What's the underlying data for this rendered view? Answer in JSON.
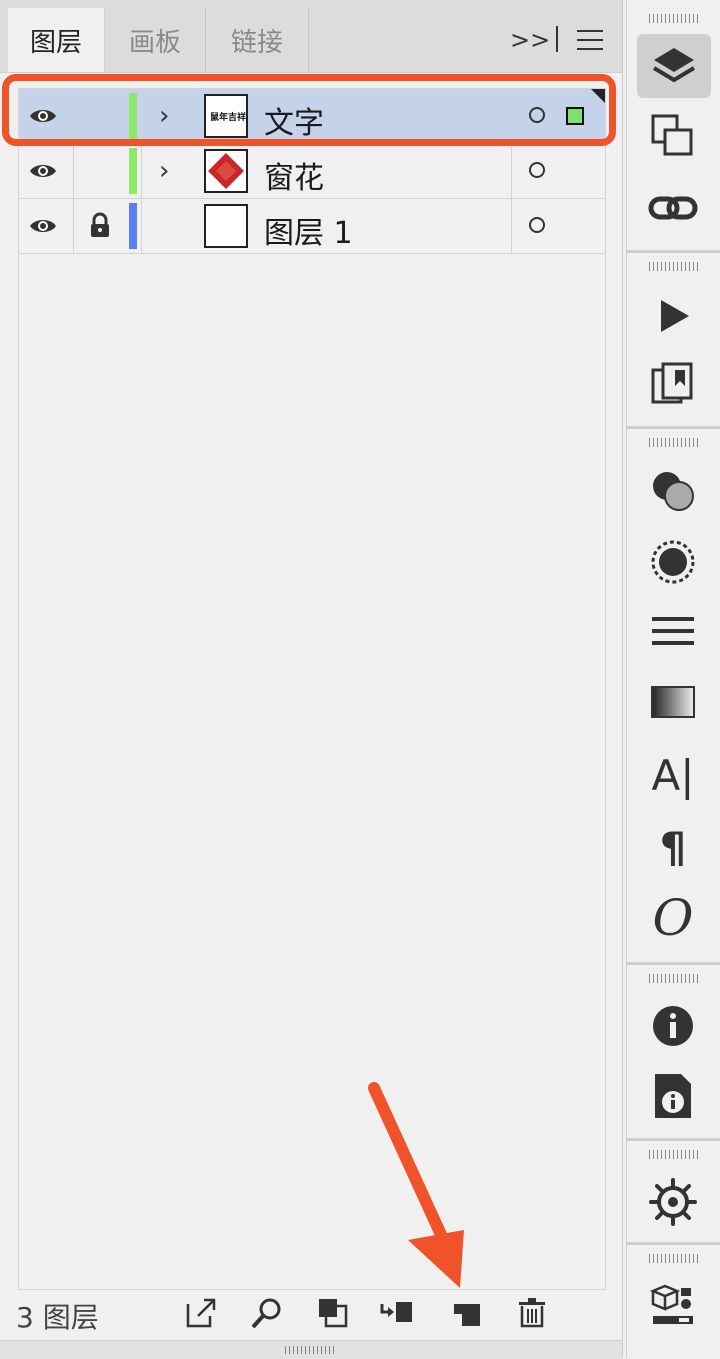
{
  "tabs": [
    {
      "label": "图层",
      "active": true
    },
    {
      "label": "画板",
      "active": false
    },
    {
      "label": "链接",
      "active": false
    }
  ],
  "tab_overflow_label": ">>",
  "layers": [
    {
      "name": "文字",
      "thumb_text": "鼠年吉祥",
      "color": "#8ee86b",
      "selected": true,
      "expandable": true,
      "locked": false
    },
    {
      "name": "窗花",
      "thumb_text": "",
      "color": "#8ee86b",
      "selected": false,
      "expandable": true,
      "locked": false
    },
    {
      "name": "图层 1",
      "thumb_text": "",
      "color": "#5b7ef0",
      "selected": false,
      "expandable": false,
      "locked": true
    }
  ],
  "footer": {
    "count_label": "3 图层"
  },
  "colors": {
    "highlight": "#f0522a",
    "selected_row": "#c5d3ea",
    "arrow": "#f0522a"
  },
  "footer_icons": [
    "export-icon",
    "search-icon",
    "clip-mask-icon",
    "move-to-layer-icon",
    "new-sublayer-icon",
    "trash-icon"
  ],
  "toolbar_icons": [
    "layers-icon",
    "artboards-icon",
    "links-icon",
    "actions-play-icon",
    "asset-export-icon",
    "transparency-icon",
    "appearance-icon",
    "stroke-icon",
    "gradient-icon",
    "character-icon",
    "paragraph-icon",
    "opentype-icon",
    "info-icon",
    "document-info-icon",
    "navigator-icon",
    "libraries-icon"
  ]
}
